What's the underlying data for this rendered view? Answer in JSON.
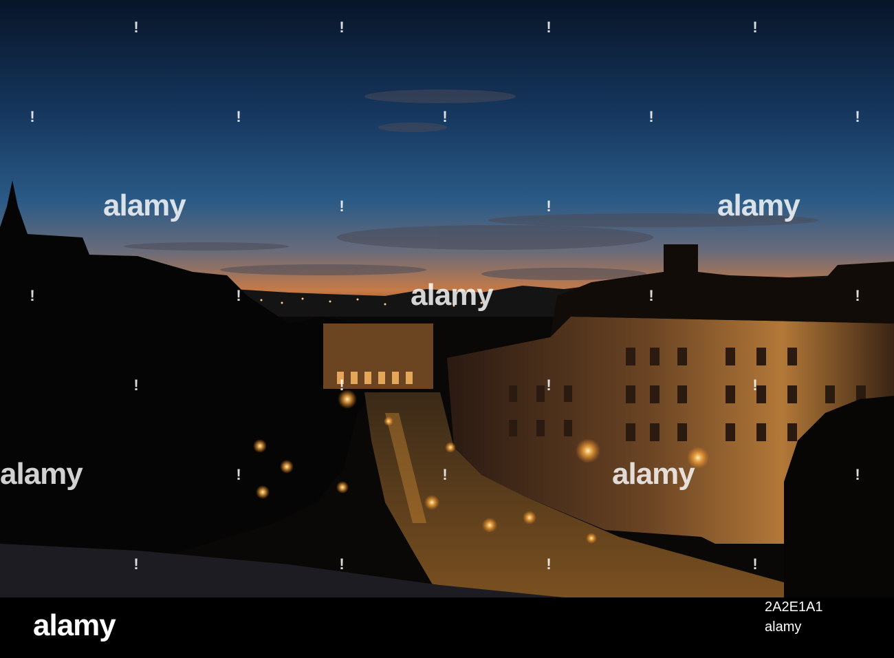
{
  "watermark": {
    "brand": "alamy",
    "image_id": "2A2E1A1",
    "footer_brand": "alamy"
  },
  "colors": {
    "sky_top": "#0a1a33",
    "sky_mid": "#1d4a78",
    "horizon_glow": "#d77a3a",
    "street_light": "#ffb347",
    "building_lit": "#c98a4a"
  }
}
